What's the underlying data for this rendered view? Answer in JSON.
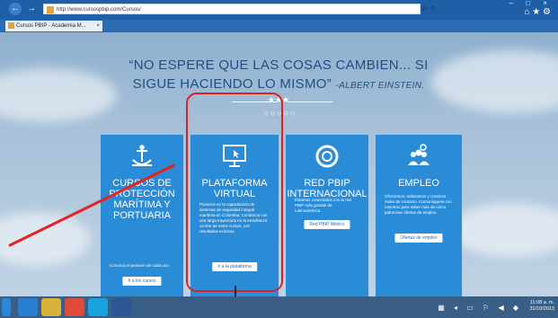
{
  "browser": {
    "url": "http://www.cursospbip.com/Cursos/",
    "tab_title": "Cursos PBIP - Academia M...",
    "tab_close": "×",
    "address_tools": "ρ - c",
    "nav_back": "←",
    "nav_forward": "→",
    "window_controls": "–  □  ×",
    "toolbar_icons": "⌂ ★ ⚙"
  },
  "page": {
    "quote": "“NO ESPERE QUE LAS COSAS CAMBIEN... SI SIGUE HACIENDO LO MISMO”",
    "author": "-ALBERT EINSTEIN.",
    "stars": "★★★",
    "dots": "○○○○○",
    "cards": [
      {
        "title": "CURSOS DE PROTECCIÓN MARÍTIMA Y PORTUARIA",
        "text": "Conozca el pensum de cada uno.",
        "button": "Ir a los cursos",
        "icon": "anchor-ship-icon"
      },
      {
        "title": "PLATAFORMA VIRTUAL",
        "text": "Pioneros en la capacitación de sistemas de seguridad integral marítima en Colombia. Contamos con una larga trayectoria en la enseñanza on-line de estos cursos, con resultados exitosos.",
        "button": "Ir a la plataforma",
        "icon": "monitor-cursor-icon"
      },
      {
        "title": "RED PBIP INTERNACIONAL",
        "text": "Estamos conectados con la red PBIP más grande de Latinoamérica.",
        "button": "Red PBIP México",
        "icon": "lifebuoy-icon"
      },
      {
        "title": "EMPLEO",
        "text": "Ofrecemos, enlazamos y creamos redes de contacto. Comuníquese con nosotros para saber más de cómo patrocinar ofertas de empleo.",
        "button": "Ofertas de empleo",
        "icon": "people-gear-icon"
      }
    ]
  },
  "taskbar": {
    "clock_time": "11:08 a. m.",
    "clock_date": "31/10/2013",
    "tray": "▦ ◂ ▭ ⚐ ◀ ◆"
  },
  "colors": {
    "card": "#2a8bd6",
    "highlight": "#e02020",
    "quote": "#1f4f86"
  }
}
